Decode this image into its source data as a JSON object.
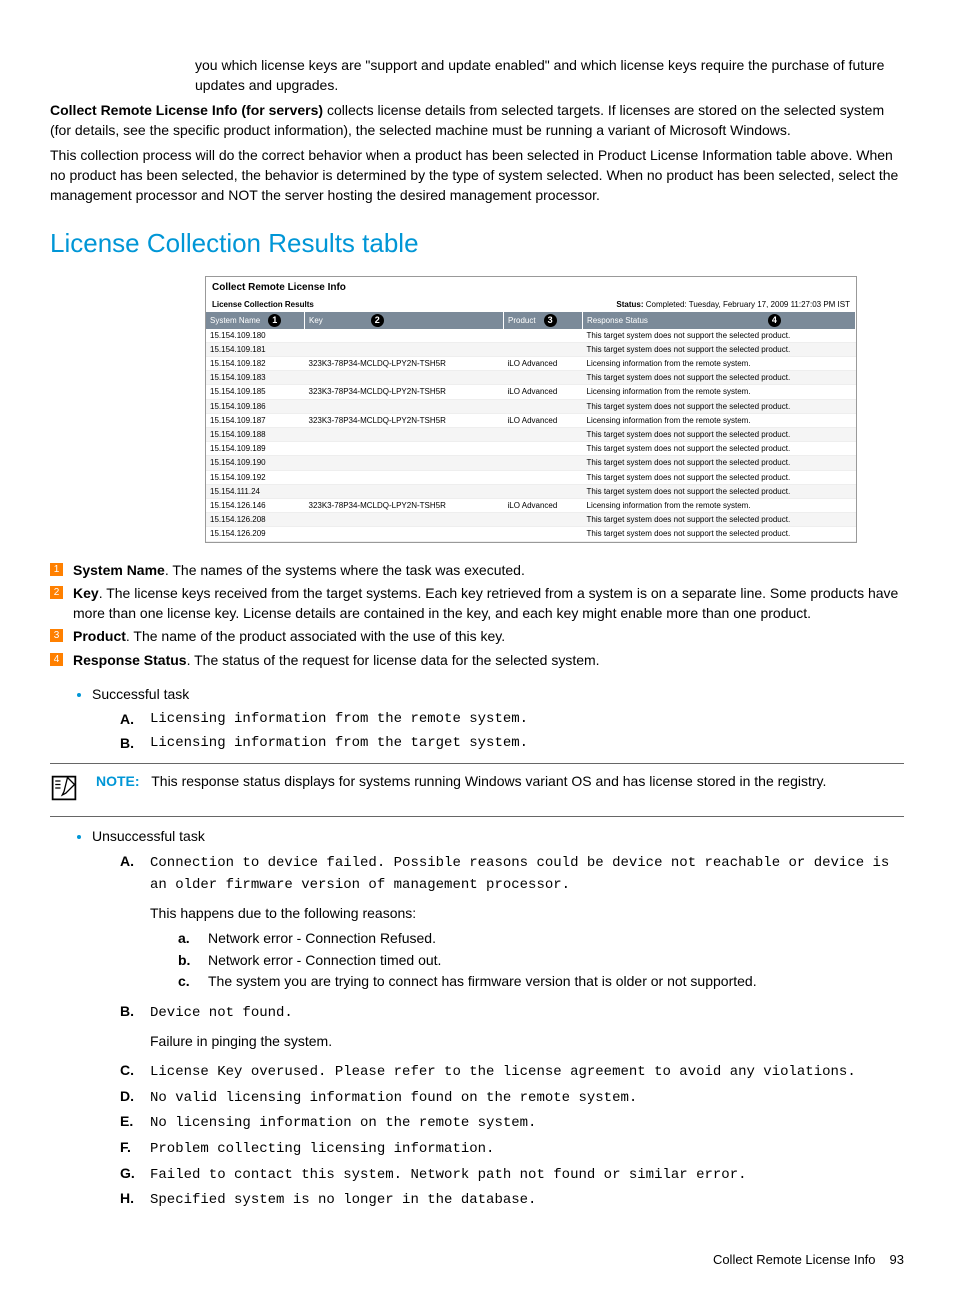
{
  "intro": {
    "p1": "you which license keys are \"support and update enabled\" and which license keys require the purchase of future updates and upgrades.",
    "p2a": "Collect Remote License Info (for servers)",
    "p2b": " collects license details from selected targets. If licenses are stored on the selected system (for details, see the specific product information), the selected machine must be running a variant of Microsoft Windows.",
    "p3": "This collection process will do the correct behavior when a product has been selected in Product License Information table above. When no product has been selected, the behavior is determined by the type of system selected. When no product has been selected, select the management processor and NOT the server hosting the desired management processor."
  },
  "heading": "License Collection Results table",
  "screenshot": {
    "title": "Collect Remote License Info",
    "subtitle_left": "License Collection Results",
    "subtitle_right_label": "Status:",
    "subtitle_right_value": " Completed: Tuesday, February 17, 2009 11:27:03 PM IST",
    "headers": {
      "c1": "System Name",
      "c2": "Key",
      "c3": "Product",
      "c4": "Response Status"
    },
    "callouts": {
      "c1": "1",
      "c2": "2",
      "c3": "3",
      "c4": "4"
    },
    "rows": [
      {
        "sys": "15.154.109.180",
        "key": "",
        "prod": "",
        "resp": "This target system does not support the selected product."
      },
      {
        "sys": "15.154.109.181",
        "key": "",
        "prod": "",
        "resp": "This target system does not support the selected product."
      },
      {
        "sys": "15.154.109.182",
        "key": "323K3-78P34-MCLDQ-LPY2N-TSH5R",
        "prod": "iLO Advanced",
        "resp": "Licensing information from the remote system."
      },
      {
        "sys": "15.154.109.183",
        "key": "",
        "prod": "",
        "resp": "This target system does not support the selected product."
      },
      {
        "sys": "15.154.109.185",
        "key": "323K3-78P34-MCLDQ-LPY2N-TSH5R",
        "prod": "iLO Advanced",
        "resp": "Licensing information from the remote system."
      },
      {
        "sys": "15.154.109.186",
        "key": "",
        "prod": "",
        "resp": "This target system does not support the selected product."
      },
      {
        "sys": "15.154.109.187",
        "key": "323K3-78P34-MCLDQ-LPY2N-TSH5R",
        "prod": "iLO Advanced",
        "resp": "Licensing information from the remote system."
      },
      {
        "sys": "15.154.109.188",
        "key": "",
        "prod": "",
        "resp": "This target system does not support the selected product."
      },
      {
        "sys": "15.154.109.189",
        "key": "",
        "prod": "",
        "resp": "This target system does not support the selected product."
      },
      {
        "sys": "15.154.109.190",
        "key": "",
        "prod": "",
        "resp": "This target system does not support the selected product."
      },
      {
        "sys": "15.154.109.192",
        "key": "",
        "prod": "",
        "resp": "This target system does not support the selected product."
      },
      {
        "sys": "15.154.111.24",
        "key": "",
        "prod": "",
        "resp": "This target system does not support the selected product."
      },
      {
        "sys": "15.154.126.146",
        "key": "323K3-78P34-MCLDQ-LPY2N-TSH5R",
        "prod": "iLO Advanced",
        "resp": "Licensing information from the remote system."
      },
      {
        "sys": "15.154.126.208",
        "key": "",
        "prod": "",
        "resp": "This target system does not support the selected product."
      },
      {
        "sys": "15.154.126.209",
        "key": "",
        "prod": "",
        "resp": "This target system does not support the selected product."
      }
    ]
  },
  "callout_list": [
    {
      "n": "1",
      "title": "System Name",
      "text": ". The names of the systems where the task was executed."
    },
    {
      "n": "2",
      "title": "Key",
      "text": ". The license keys received from the target systems. Each key retrieved from a system is on a separate line. Some products have more than one license key. License details are contained in the key, and each key might enable more than one product."
    },
    {
      "n": "3",
      "title": "Product",
      "text": ". The name of the product associated with the use of this key."
    },
    {
      "n": "4",
      "title": "Response Status",
      "text": ". The status of the request for license data for the selected system."
    }
  ],
  "successful": {
    "label": "Successful task",
    "items": [
      {
        "m": "A.",
        "t": "Licensing information from the remote system."
      },
      {
        "m": "B.",
        "t": "Licensing information from the target system."
      }
    ]
  },
  "note": {
    "label": "NOTE:",
    "text": "This response status displays for systems running Windows variant OS and has license stored in the registry."
  },
  "unsuccessful": {
    "label": "Unsuccessful task",
    "A_text": "Connection to device failed. Possible reasons could be device not reachable or device is an older firmware version of management processor.",
    "A_followup": "This happens due to the following reasons:",
    "A_sub": [
      {
        "m": "a.",
        "t": "Network error - Connection Refused."
      },
      {
        "m": "b.",
        "t": "Network error - Connection timed out."
      },
      {
        "m": "c.",
        "t": "The system you are trying to connect has firmware version that is older or not supported."
      }
    ],
    "rest": [
      {
        "m": "B.",
        "t": "Device not found.",
        "follow": "Failure in pinging the system."
      },
      {
        "m": "C.",
        "t": "License Key overused. Please refer to the license agreement to avoid any violations."
      },
      {
        "m": "D.",
        "t": "No valid licensing information found on the remote system."
      },
      {
        "m": "E.",
        "t": "No licensing information on the remote system."
      },
      {
        "m": "F.",
        "t": "Problem collecting licensing information."
      },
      {
        "m": "G.",
        "t": "Failed to contact this system. Network path not found or similar error."
      },
      {
        "m": "H.",
        "t": "Specified system is no longer in the database."
      }
    ]
  },
  "footer": {
    "title": "Collect Remote License Info",
    "page": "93"
  }
}
